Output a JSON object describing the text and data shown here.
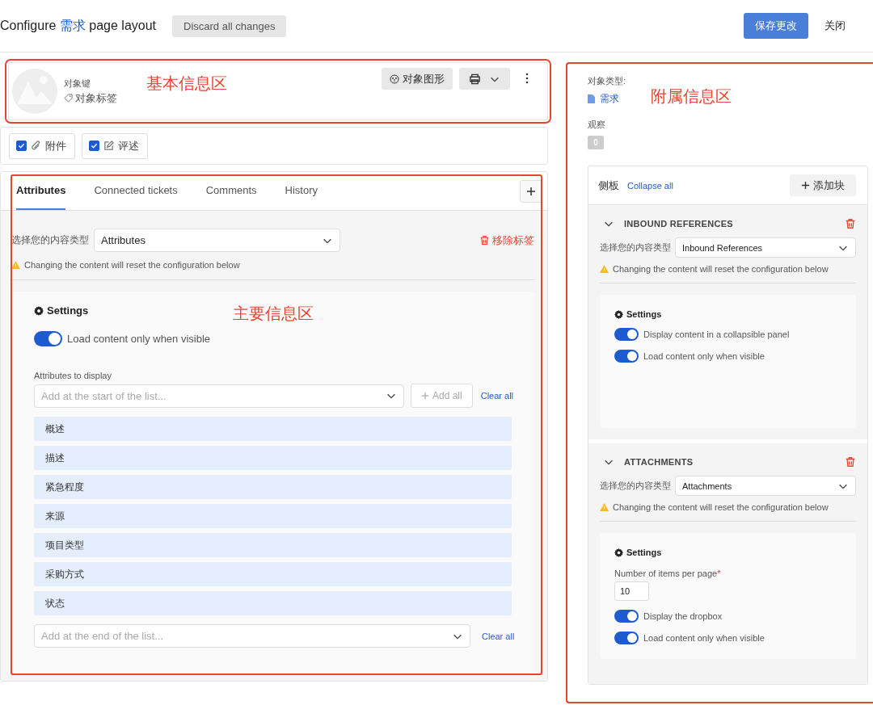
{
  "header": {
    "title_before": "Configure",
    "title_object": "需求",
    "title_after": "page layout",
    "discard": "Discard all changes",
    "save": "保存更改",
    "close": "关闭"
  },
  "basic_info": {
    "annotation": "基本信息区",
    "key": "对象键",
    "label": "对象标签",
    "graph_button": "对象图形"
  },
  "toggles": [
    {
      "label": "附件",
      "checked": true,
      "kind": "attachment"
    },
    {
      "label": "评述",
      "checked": true,
      "kind": "comment"
    }
  ],
  "main": {
    "annotation": "主要信息区",
    "tabs": [
      {
        "label": "Attributes",
        "selected": true
      },
      {
        "label": "Connected tickets",
        "selected": false
      },
      {
        "label": "Comments",
        "selected": false
      },
      {
        "label": "History",
        "selected": false
      }
    ],
    "content_type_label": "选择您的内容类型",
    "content_type": "Attributes",
    "remove_tab": "移除标签",
    "warning": "Changing the content will reset the configuration below",
    "settings_title": "Settings",
    "switches": [
      {
        "label": "Load content only when visible",
        "on": true
      }
    ],
    "attributes_label": "Attributes to display",
    "add_start_placeholder": "Add at the start of the list...",
    "add_all": "Add all",
    "clear_all_top": "Clear all",
    "attributes": [
      "概述",
      "描述",
      "紧急程度",
      "来源",
      "项目类型",
      "采购方式",
      "状态"
    ],
    "add_end_placeholder": "Add at the end of the list...",
    "clear_all_bottom": "Clear all"
  },
  "sidebar": {
    "annotation": "附属信息区",
    "object_type_label": "对象类型:",
    "object_type": "需求",
    "watchers_label": "观察",
    "watchers_count": "0",
    "panel_title": "侧板",
    "collapse_all": "Collapse all",
    "add_block": "添加块",
    "blocks": [
      {
        "title": "INBOUND REFERENCES",
        "expanded": true,
        "content_type_label": "选择您的内容类型",
        "content_type": "Inbound References",
        "warning": "Changing the content will reset the configuration below",
        "settings_title": "Settings",
        "fields": [
          {
            "kind": "switch",
            "label": "Display content in a collapsible panel",
            "on": true
          },
          {
            "kind": "switch",
            "label": "Load content only when visible",
            "on": true
          }
        ]
      },
      {
        "title": "ATTACHMENTS",
        "expanded": true,
        "content_type_label": "选择您的内容类型",
        "content_type": "Attachments",
        "warning": "Changing the content will reset the configuration below",
        "settings_title": "Settings",
        "fields": [
          {
            "kind": "number",
            "label": "Number of items per page",
            "required_mark": "*",
            "value": "10"
          },
          {
            "kind": "switch",
            "label": "Display the dropbox",
            "on": true
          },
          {
            "kind": "switch",
            "label": "Load content only when visible",
            "on": true
          }
        ]
      }
    ]
  }
}
